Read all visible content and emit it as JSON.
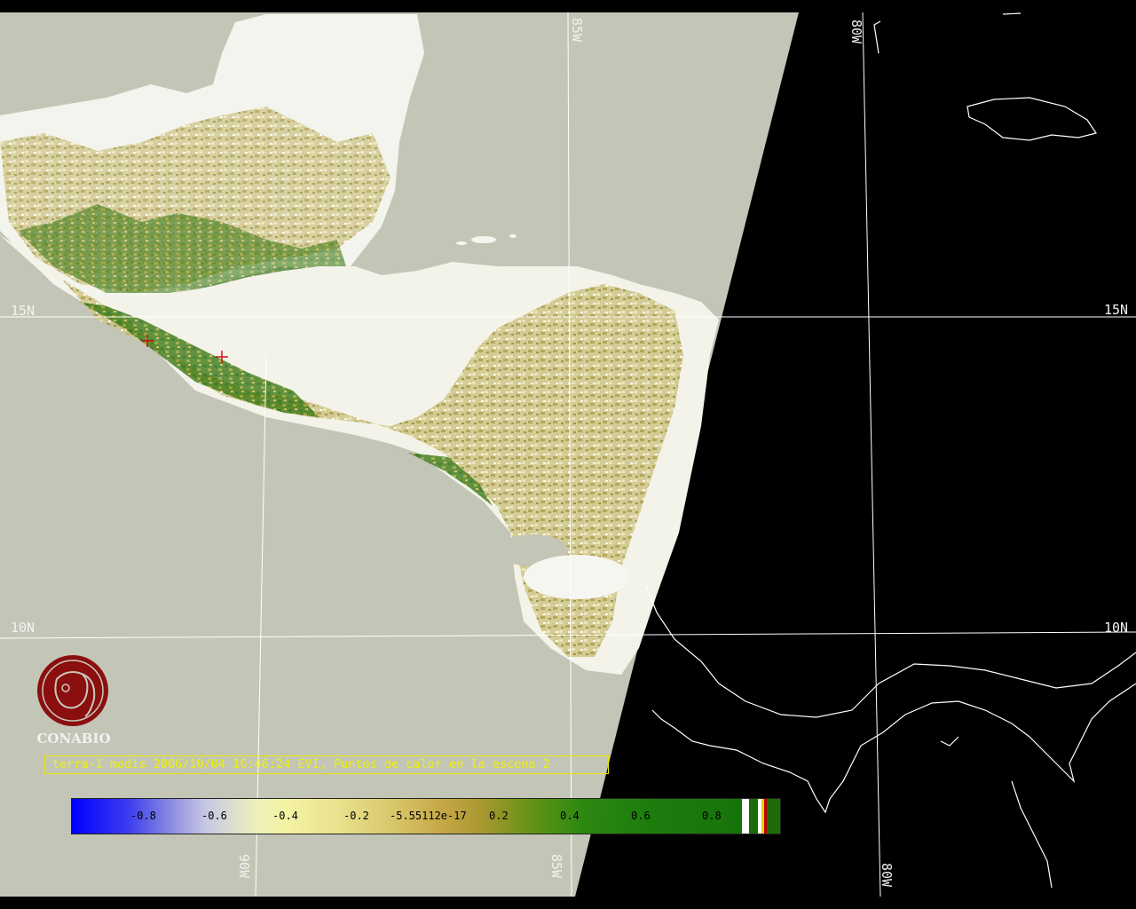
{
  "map": {
    "lat_labels": [
      "15N",
      "15N",
      "10N",
      "10N"
    ],
    "lon_labels": [
      "85W",
      "80W",
      "90W",
      "85W",
      "80W"
    ],
    "fire_markers": 2
  },
  "logo": {
    "text": "CONABIO"
  },
  "title": "terra-1 modis 2006/10/04 16:46:24 EVI, Puntos de calor en la escena 2",
  "colorbar": {
    "ticks": [
      "-0.8",
      "-0.6",
      "-0.4",
      "-0.2",
      "-5.55112e-17",
      "0.2",
      "0.4",
      "0.6",
      "0.8"
    ],
    "swatch_colors": [
      "#ffffff",
      "#1c6c08",
      "#ffffff",
      "#e8d400",
      "#c00000",
      "#1c6c08"
    ]
  },
  "colors": {
    "ocean": "#c3c6b6",
    "outside_scene": "#000000",
    "graticule": "#ffffff",
    "title_text": "#f0f000",
    "logo": "#8b0f0f"
  }
}
